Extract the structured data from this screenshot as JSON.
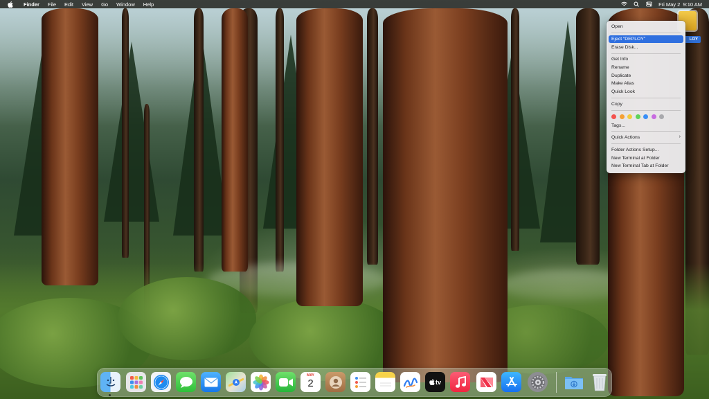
{
  "menubar": {
    "app_name": "Finder",
    "menus": [
      "File",
      "Edit",
      "View",
      "Go",
      "Window",
      "Help"
    ],
    "clock": "Fri May 2  9:10 AM"
  },
  "desktop": {
    "drive_label": "DEPLOY",
    "drive_label_visible": "LOY"
  },
  "context_menu": {
    "items": {
      "open": "Open",
      "eject": "Eject “DEPLOY”",
      "erase": "Erase Disk...",
      "get_info": "Get Info",
      "rename": "Rename",
      "duplicate": "Duplicate",
      "make_alias": "Make Alias",
      "quick_look": "Quick Look",
      "copy": "Copy",
      "tags": "Tags...",
      "quick_actions": "Quick Actions",
      "folder_actions": "Folder Actions Setup...",
      "new_terminal": "New Terminal at Folder",
      "new_terminal_tab": "New Terminal Tab at Folder"
    },
    "tag_colors": [
      "#f4524d",
      "#f5a033",
      "#f2cc3d",
      "#5fd35a",
      "#3b8ff7",
      "#c86be0",
      "#a9a9ad"
    ]
  },
  "dock": {
    "calendar_month": "MAY",
    "calendar_day": "2",
    "tv_label": "tv",
    "apps": [
      "finder",
      "launchpad",
      "safari",
      "messages",
      "mail",
      "maps",
      "photos",
      "facetime",
      "calendar",
      "contacts",
      "reminders",
      "notes",
      "freeform",
      "tv",
      "music",
      "news",
      "app-store",
      "system-settings",
      "downloads",
      "trash"
    ]
  }
}
